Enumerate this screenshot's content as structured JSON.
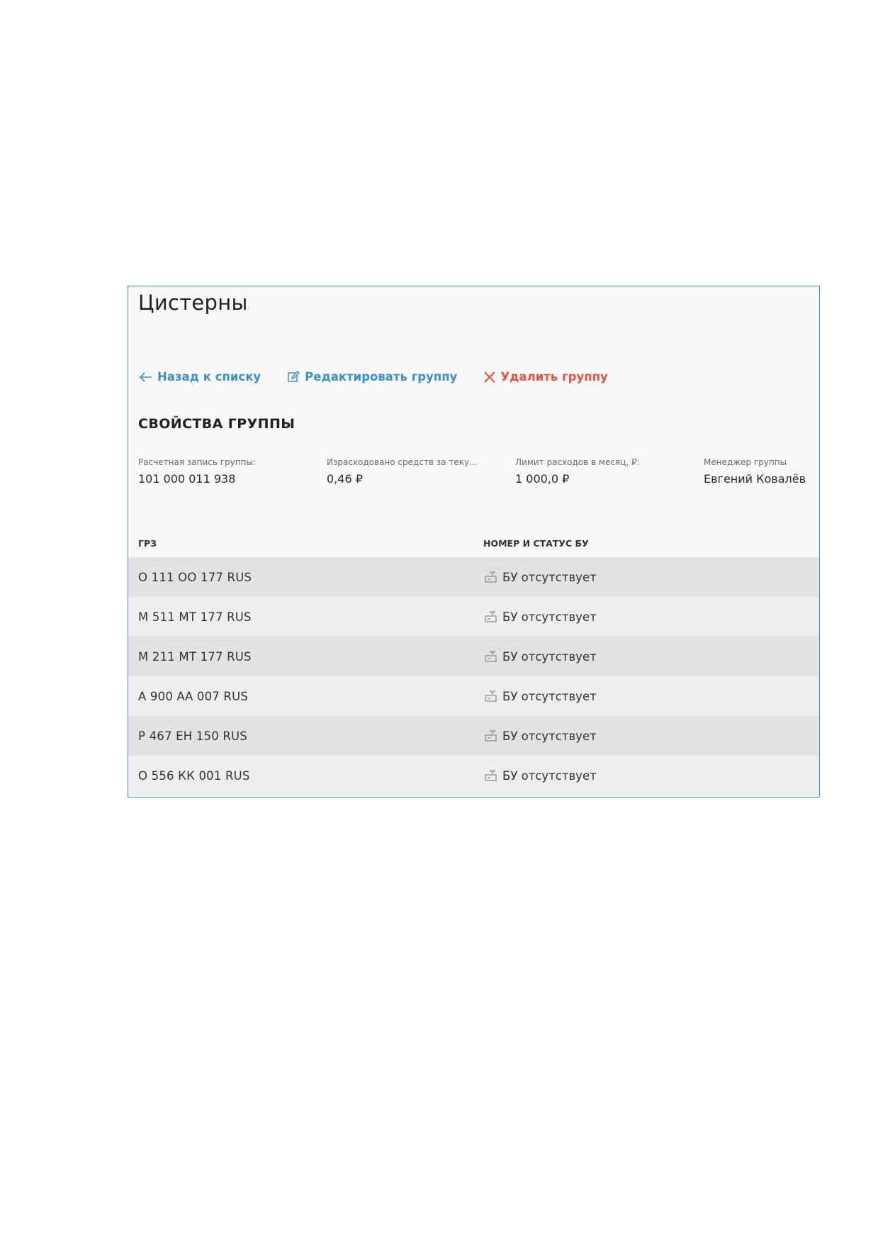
{
  "page": {
    "title": "Цистерны"
  },
  "actions": {
    "back_label": "Назад к списку",
    "edit_label": "Редактировать группу",
    "delete_label": "Удалить группу"
  },
  "properties": {
    "section_title": "СВОЙСТВА ГРУППЫ",
    "items": [
      {
        "label": "Расчетная запись группы:",
        "value": "101 000 011 938"
      },
      {
        "label": "Израсходовано средств за теку...",
        "value": "0,46 ₽"
      },
      {
        "label": "Лимит расходов в месяц, ₽:",
        "value": "1 000,0 ₽"
      },
      {
        "label": "Менеджер группы",
        "value": "Евгений Ковалёв"
      }
    ]
  },
  "table": {
    "columns": [
      "ГРЗ",
      "НОМЕР И СТАТУС БУ"
    ],
    "rows": [
      {
        "plate": "О 111 ОО 177 RUS",
        "status": "БУ отсутствует"
      },
      {
        "plate": "М 511 МТ 177 RUS",
        "status": "БУ отсутствует"
      },
      {
        "plate": "М 211 МТ 177 RUS",
        "status": "БУ отсутствует"
      },
      {
        "plate": "А 900 АА 007 RUS",
        "status": "БУ отсутствует"
      },
      {
        "plate": "Р 467 ЕН 150 RUS",
        "status": "БУ отсутствует"
      },
      {
        "plate": "О 556 КК 001 RUS",
        "status": "БУ отсутствует"
      }
    ]
  },
  "colors": {
    "link_blue": "#3e8fc6",
    "delete_red": "#e35444",
    "panel_border": "#4a90c9"
  },
  "icons": {
    "back": "arrow-left-icon",
    "edit": "edit-icon",
    "delete": "close-icon",
    "status": "device-icon"
  }
}
